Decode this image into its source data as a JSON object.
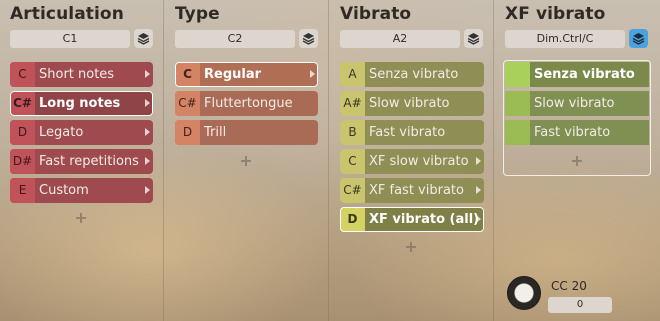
{
  "columns": [
    {
      "title": "Articulation",
      "key": "C1",
      "items": [
        {
          "key": "C",
          "label": "Short notes",
          "arrow": true,
          "selected": false
        },
        {
          "key": "C#",
          "label": "Long notes",
          "arrow": true,
          "selected": true
        },
        {
          "key": "D",
          "label": "Legato",
          "arrow": true,
          "selected": false
        },
        {
          "key": "D#",
          "label": "Fast repetitions",
          "arrow": true,
          "selected": false
        },
        {
          "key": "E",
          "label": "Custom",
          "arrow": true,
          "selected": false
        }
      ]
    },
    {
      "title": "Type",
      "key": "C2",
      "items": [
        {
          "key": "C",
          "label": "Regular",
          "arrow": true,
          "selected": true
        },
        {
          "key": "C#",
          "label": "Fluttertongue",
          "arrow": false,
          "selected": false
        },
        {
          "key": "D",
          "label": "Trill",
          "arrow": false,
          "selected": false
        }
      ]
    },
    {
      "title": "Vibrato",
      "key": "A2",
      "items": [
        {
          "key": "A",
          "label": "Senza vibrato",
          "arrow": false,
          "selected": false
        },
        {
          "key": "A#",
          "label": "Slow vibrato",
          "arrow": false,
          "selected": false
        },
        {
          "key": "B",
          "label": "Fast vibrato",
          "arrow": false,
          "selected": false
        },
        {
          "key": "C",
          "label": "XF slow vibrato",
          "arrow": true,
          "selected": false
        },
        {
          "key": "C#",
          "label": "XF fast vibrato",
          "arrow": true,
          "selected": false
        },
        {
          "key": "D",
          "label": "XF vibrato (all)",
          "arrow": true,
          "selected": true
        }
      ]
    },
    {
      "title": "XF vibrato",
      "key": "Dim.Ctrl/C",
      "items": [
        {
          "key": "",
          "label": "Senza vibrato",
          "arrow": false,
          "selected": true
        },
        {
          "key": "",
          "label": "Slow vibrato",
          "arrow": false,
          "selected": false
        },
        {
          "key": "",
          "label": "Fast vibrato",
          "arrow": false,
          "selected": false
        }
      ]
    }
  ],
  "plus_symbol": "+",
  "controller": {
    "label": "CC 20",
    "value": "0"
  },
  "colors": {
    "articulation": "#c0525a",
    "type": "#d48365",
    "vibrato": "#c9c56f",
    "xf_vibrato": "#9bbb55",
    "layer_active": "#4aa3e0"
  }
}
